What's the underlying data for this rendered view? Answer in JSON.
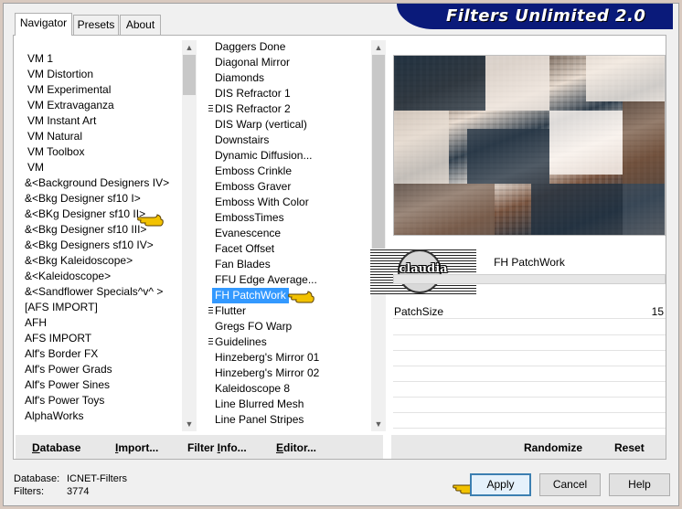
{
  "window": {
    "banner_title": "Filters Unlimited 2.0"
  },
  "tabs": [
    {
      "label": "Navigator",
      "active": true
    },
    {
      "label": "Presets",
      "active": false
    },
    {
      "label": "About",
      "active": false
    }
  ],
  "categories": [
    "VM 1",
    "VM Distortion",
    "VM Experimental",
    "VM Extravaganza",
    "VM Instant Art",
    "VM Natural",
    "VM Toolbox",
    "VM",
    "&<Background Designers IV>",
    "&<Bkg Designer sf10 I>",
    "&<BKg Designer sf10 II>",
    "&<Bkg Designer sf10 III>",
    "&<Bkg Designers sf10 IV>",
    "&<Bkg Kaleidoscope>",
    "&<Kaleidoscope>",
    "&<Sandflower Specials^v^ >",
    "[AFS IMPORT]",
    "AFH",
    "AFS IMPORT",
    "Alf's Border FX",
    "Alf's Power Grads",
    "Alf's Power Sines",
    "Alf's Power Toys",
    "AlphaWorks"
  ],
  "filters": [
    "Daggers Done",
    "Diagonal Mirror",
    "Diamonds",
    "DIS Refractor 1",
    "DIS Refractor 2",
    "DIS Warp (vertical)",
    "Downstairs",
    "Dynamic Diffusion...",
    "Emboss Crinkle",
    "Emboss Graver",
    "Emboss With Color",
    "EmbossTimes",
    "Evanescence",
    "Facet Offset",
    "Fan Blades",
    "FFU Edge Average...",
    "FH PatchWork",
    "Flutter",
    "Gregs FO Warp",
    "Guidelines",
    "Hinzeberg's Mirror 01",
    "Hinzeberg's Mirror 02",
    "Kaleidoscope 8",
    "Line Blurred Mesh",
    "Line Panel Stripes"
  ],
  "selected_filter": "FH PatchWork",
  "logo_text": "claudia",
  "parameters": [
    {
      "name": "PatchSize",
      "value": "15"
    }
  ],
  "left_buttons": {
    "database": {
      "u": "D",
      "rest": "atabase"
    },
    "import": {
      "u": "I",
      "rest": "mport..."
    },
    "filter_info": {
      "pre": "Filter ",
      "u": "I",
      "rest": "nfo..."
    },
    "editor": {
      "u": "E",
      "rest": "ditor..."
    }
  },
  "right_buttons": {
    "randomize": "Randomize",
    "reset": "Reset"
  },
  "status": {
    "database_label": "Database:",
    "database_value": "ICNET-Filters",
    "filters_label": "Filters:",
    "filters_value": "3774"
  },
  "dialog_buttons": {
    "apply": "Apply",
    "cancel": "Cancel",
    "help": "Help"
  },
  "colors": {
    "banner": "#0a1a7a",
    "selection": "#3399ff",
    "hand": "#f2c200"
  }
}
